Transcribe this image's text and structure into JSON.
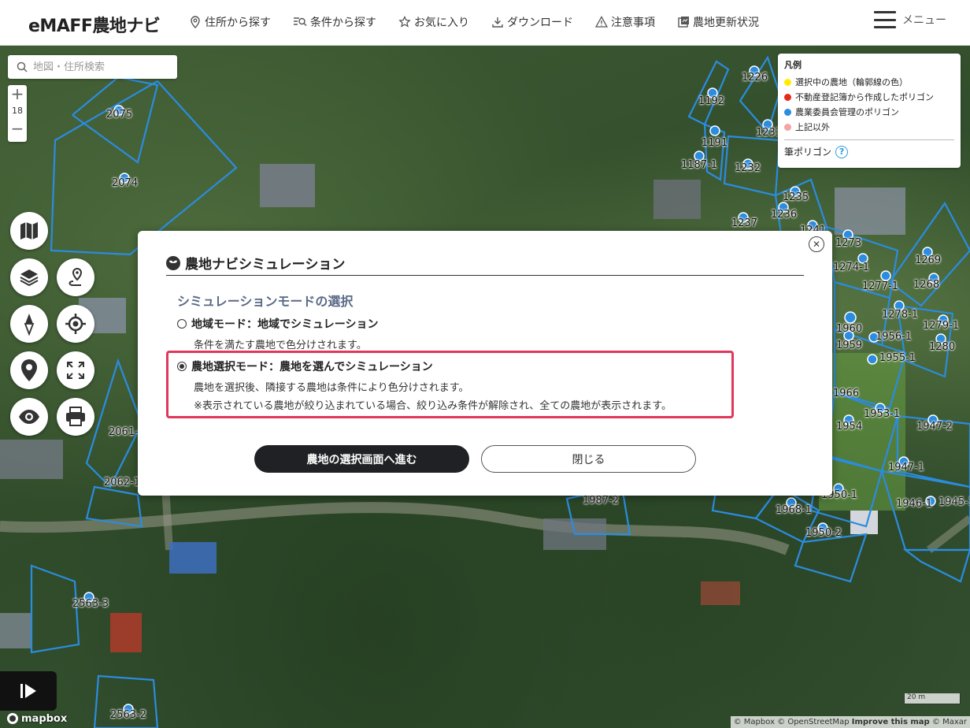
{
  "header": {
    "logo": "eMAFF農地ナビ",
    "nav": [
      {
        "label": "住所から探す",
        "icon": "map-pin-icon"
      },
      {
        "label": "条件から探す",
        "icon": "filter-search-icon"
      },
      {
        "label": "お気に入り",
        "icon": "star-icon"
      },
      {
        "label": "ダウンロード",
        "icon": "download-icon"
      },
      {
        "label": "注意事項",
        "icon": "warning-icon"
      },
      {
        "label": "農地更新状況",
        "icon": "update-icon"
      }
    ],
    "menu_label": "メニュー"
  },
  "map": {
    "search_placeholder": "地図・住所検索",
    "zoom_level": "18",
    "zoom_in": "+",
    "zoom_out": "−",
    "parcel_labels": [
      "2075",
      "2074",
      "1192",
      "1226",
      "1191",
      "1187-1",
      "1232",
      "1235",
      "1236",
      "1237",
      "1241",
      "1273",
      "1274-1",
      "1269",
      "1277-1",
      "1268",
      "1278-1",
      "1279-1",
      "1960",
      "1956-1",
      "1959",
      "1280",
      "1955-1",
      "1966",
      "1953-1",
      "1954",
      "1947-2",
      "1947-1",
      "1950-1",
      "1946-1",
      "1945-1",
      "1968-1",
      "1950-2",
      "1987-2",
      "2061-1",
      "2062-1",
      "2563-3",
      "2563-2",
      "1233"
    ],
    "scale_label": "20 m",
    "attribution_a": "© Mapbox © OpenStreetMap",
    "attribution_b": "Improve this map",
    "attribution_c": "© Maxar",
    "mapbox_logo": "mapbox"
  },
  "legend": {
    "title": "凡例",
    "items": [
      {
        "label": "選択中の農地（輪郭線の色）",
        "color": "#ffee00"
      },
      {
        "label": "不動産登記簿から作成したポリゴン",
        "color": "#e52a1c"
      },
      {
        "label": "農業委員会管理のポリゴン",
        "color": "#2b8ce0"
      },
      {
        "label": "上記以外",
        "color": "#f2a5a5"
      }
    ],
    "polygon_label": "筆ポリゴン",
    "help": "?"
  },
  "modal": {
    "title": "農地ナビシミュレーション",
    "section": "シミュレーションモードの選択",
    "option1": {
      "label": "地域モード：地域でシミュレーション",
      "desc": "条件を満たす農地で色分けされます。",
      "selected": false
    },
    "option2": {
      "label": "農地選択モード：農地を選んでシミュレーション",
      "desc1": "農地を選択後、隣接する農地は条件により色分けされます。",
      "desc2": "※表示されている農地が絞り込まれている場合、絞り込み条件が解除され、全ての農地が表示されます。",
      "selected": true
    },
    "primary_button": "農地の選択画面へ進む",
    "secondary_button": "閉じる",
    "close": "✕"
  },
  "colors": {
    "polygon_blue": "#2b8ce0",
    "highlight": "#e0375a",
    "primary_btn": "#202125",
    "section_text": "#5a6a86"
  }
}
